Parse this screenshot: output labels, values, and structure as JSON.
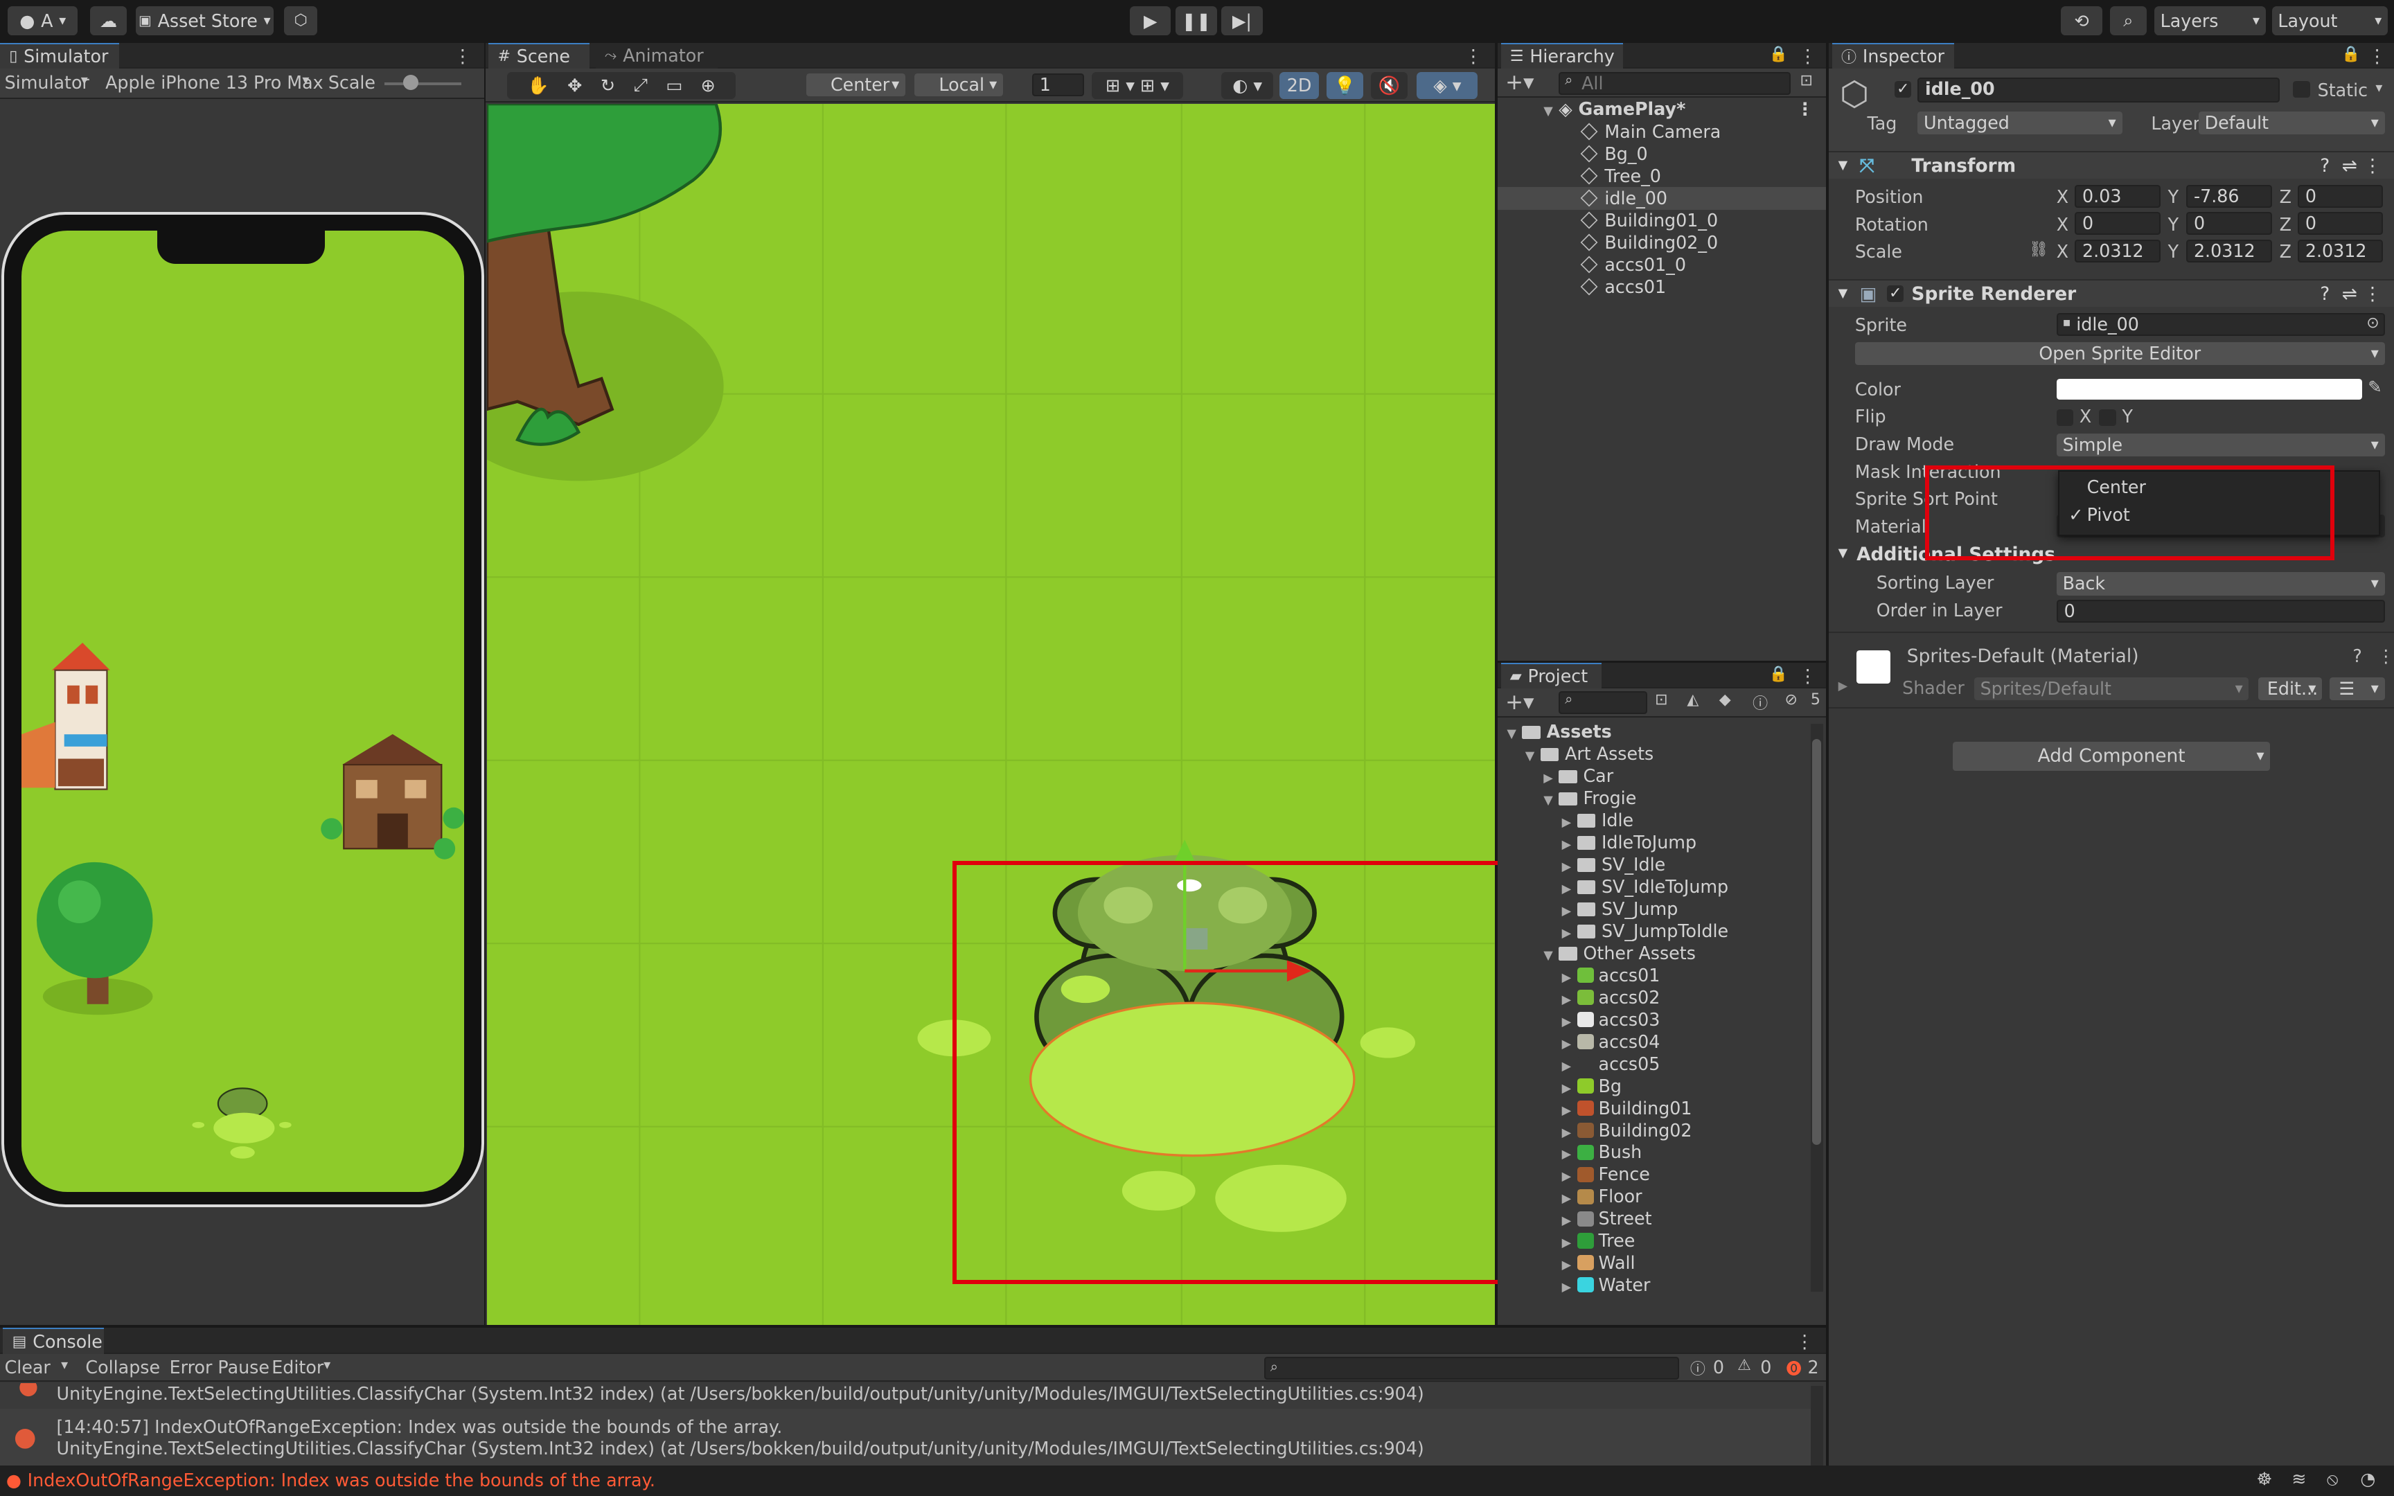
{
  "toolbar": {
    "account_label": "A",
    "asset_store_label": "Asset Store",
    "layers_label": "Layers",
    "layout_label": "Layout"
  },
  "simulator": {
    "tab_label": "Simulator",
    "mode_label": "Simulator",
    "device_label": "Apple iPhone 13 Pro Max",
    "scale_label": "Scale"
  },
  "scene": {
    "tab_scene": "Scene",
    "tab_animator": "Animator",
    "pivot_label": "Center",
    "space_label": "Local",
    "grid_value": "1",
    "mode_2d": "2D"
  },
  "hierarchy": {
    "tab_label": "Hierarchy",
    "search_placeholder": "All",
    "root": "GamePlay*",
    "items": [
      "Main Camera",
      "Bg_0",
      "Tree_0",
      "idle_00",
      "Building01_0",
      "Building02_0",
      "accs01_0",
      "accs01"
    ],
    "selected_index": 3
  },
  "project": {
    "tab_label": "Project",
    "hidden_count": "5",
    "tree": [
      {
        "label": "Assets",
        "depth": 0,
        "expanded": true,
        "bold": true
      },
      {
        "label": "Art Assets",
        "depth": 1,
        "expanded": true
      },
      {
        "label": "Car",
        "depth": 2,
        "expanded": false
      },
      {
        "label": "Frogie",
        "depth": 2,
        "expanded": true
      },
      {
        "label": "Idle",
        "depth": 3,
        "expanded": false
      },
      {
        "label": "IdleToJump",
        "depth": 3,
        "expanded": false
      },
      {
        "label": "SV_Idle",
        "depth": 3,
        "expanded": false
      },
      {
        "label": "SV_IdleToJump",
        "depth": 3,
        "expanded": false
      },
      {
        "label": "SV_Jump",
        "depth": 3,
        "expanded": false
      },
      {
        "label": "SV_JumpToIdle",
        "depth": 3,
        "expanded": false
      },
      {
        "label": "Other Assets",
        "depth": 2,
        "expanded": true
      },
      {
        "label": "accs01",
        "depth": 3,
        "asset": true,
        "color": "#6fbf3b"
      },
      {
        "label": "accs02",
        "depth": 3,
        "asset": true,
        "color": "#7bbd3a"
      },
      {
        "label": "accs03",
        "depth": 3,
        "asset": true,
        "color": "#e8e8e8"
      },
      {
        "label": "accs04",
        "depth": 3,
        "asset": true,
        "color": "#b8b8a8"
      },
      {
        "label": "accs05",
        "depth": 3,
        "asset": true,
        "color": "#383838"
      },
      {
        "label": "Bg",
        "depth": 3,
        "asset": true,
        "color": "#8ecb2a"
      },
      {
        "label": "Building01",
        "depth": 3,
        "asset": true,
        "color": "#c0522c"
      },
      {
        "label": "Building02",
        "depth": 3,
        "asset": true,
        "color": "#8a5a34"
      },
      {
        "label": "Bush",
        "depth": 3,
        "asset": true,
        "color": "#3cb043"
      },
      {
        "label": "Fence",
        "depth": 3,
        "asset": true,
        "color": "#a05a2c"
      },
      {
        "label": "Floor",
        "depth": 3,
        "asset": true,
        "color": "#b58a4a"
      },
      {
        "label": "Street",
        "depth": 3,
        "asset": true,
        "color": "#8a8a8a"
      },
      {
        "label": "Tree",
        "depth": 3,
        "asset": true,
        "color": "#2e9e3a"
      },
      {
        "label": "Wall",
        "depth": 3,
        "asset": true,
        "color": "#d8a060"
      },
      {
        "label": "Water",
        "depth": 3,
        "asset": true,
        "color": "#3ad4e0"
      }
    ]
  },
  "inspector": {
    "tab_label": "Inspector",
    "object_name": "idle_00",
    "static_label": "Static",
    "tag_label": "Tag",
    "tag_value": "Untagged",
    "layer_label": "Layer",
    "layer_value": "Default",
    "transform": {
      "title": "Transform",
      "rows": [
        {
          "label": "Position",
          "x": "0.03",
          "y": "-7.86",
          "z": "0"
        },
        {
          "label": "Rotation",
          "x": "0",
          "y": "0",
          "z": "0"
        },
        {
          "label": "Scale",
          "x": "2.0312",
          "y": "2.0312",
          "z": "2.0312"
        }
      ]
    },
    "sprite_renderer": {
      "title": "Sprite Renderer",
      "sprite_label": "Sprite",
      "sprite_value": "idle_00",
      "open_editor_label": "Open Sprite Editor",
      "color_label": "Color",
      "flip_label": "Flip",
      "flip_x": "X",
      "flip_y": "Y",
      "draw_mode_label": "Draw Mode",
      "draw_mode_value": "Simple",
      "mask_label": "Mask Interaction",
      "sort_point_label": "Sprite Sort Point",
      "material_label": "Material",
      "additional_label": "Additional Settings",
      "sorting_layer_label": "Sorting Layer",
      "sorting_layer_value": "Back",
      "order_label": "Order in Layer",
      "order_value": "0"
    },
    "dropdown": {
      "options": [
        "Center",
        "Pivot"
      ],
      "checked": "Pivot",
      "check_mark": "✓"
    },
    "material_block": {
      "title": "Sprites-Default (Material)",
      "shader_label": "Shader",
      "shader_value": "Sprites/Default",
      "edit_label": "Edit..."
    },
    "add_component_label": "Add Component"
  },
  "console": {
    "tab_label": "Console",
    "clear_label": "Clear",
    "collapse_label": "Collapse",
    "error_pause_label": "Error Pause",
    "editor_label": "Editor",
    "log_count": "0",
    "warn_count": "0",
    "error_count": "2",
    "entry1_line2": "UnityEngine.TextSelectingUtilities.ClassifyChar (System.Int32 index) (at /Users/bokken/build/output/unity/unity/Modules/IMGUI/TextSelectingUtilities.cs:904)",
    "entry2_line1": "[14:40:57] IndexOutOfRangeException: Index was outside the bounds of the array.",
    "entry2_line2": "UnityEngine.TextSelectingUtilities.ClassifyChar (System.Int32 index) (at /Users/bokken/build/output/unity/unity/Modules/IMGUI/TextSelectingUtilities.cs:904)",
    "status_message": "IndexOutOfRangeException: Index was outside the bounds of the array."
  },
  "colors": {
    "accent": "#3c7fc3",
    "highlight": "#e0000c",
    "scene_green": "#8ecb2a",
    "error": "#ff5a36"
  }
}
